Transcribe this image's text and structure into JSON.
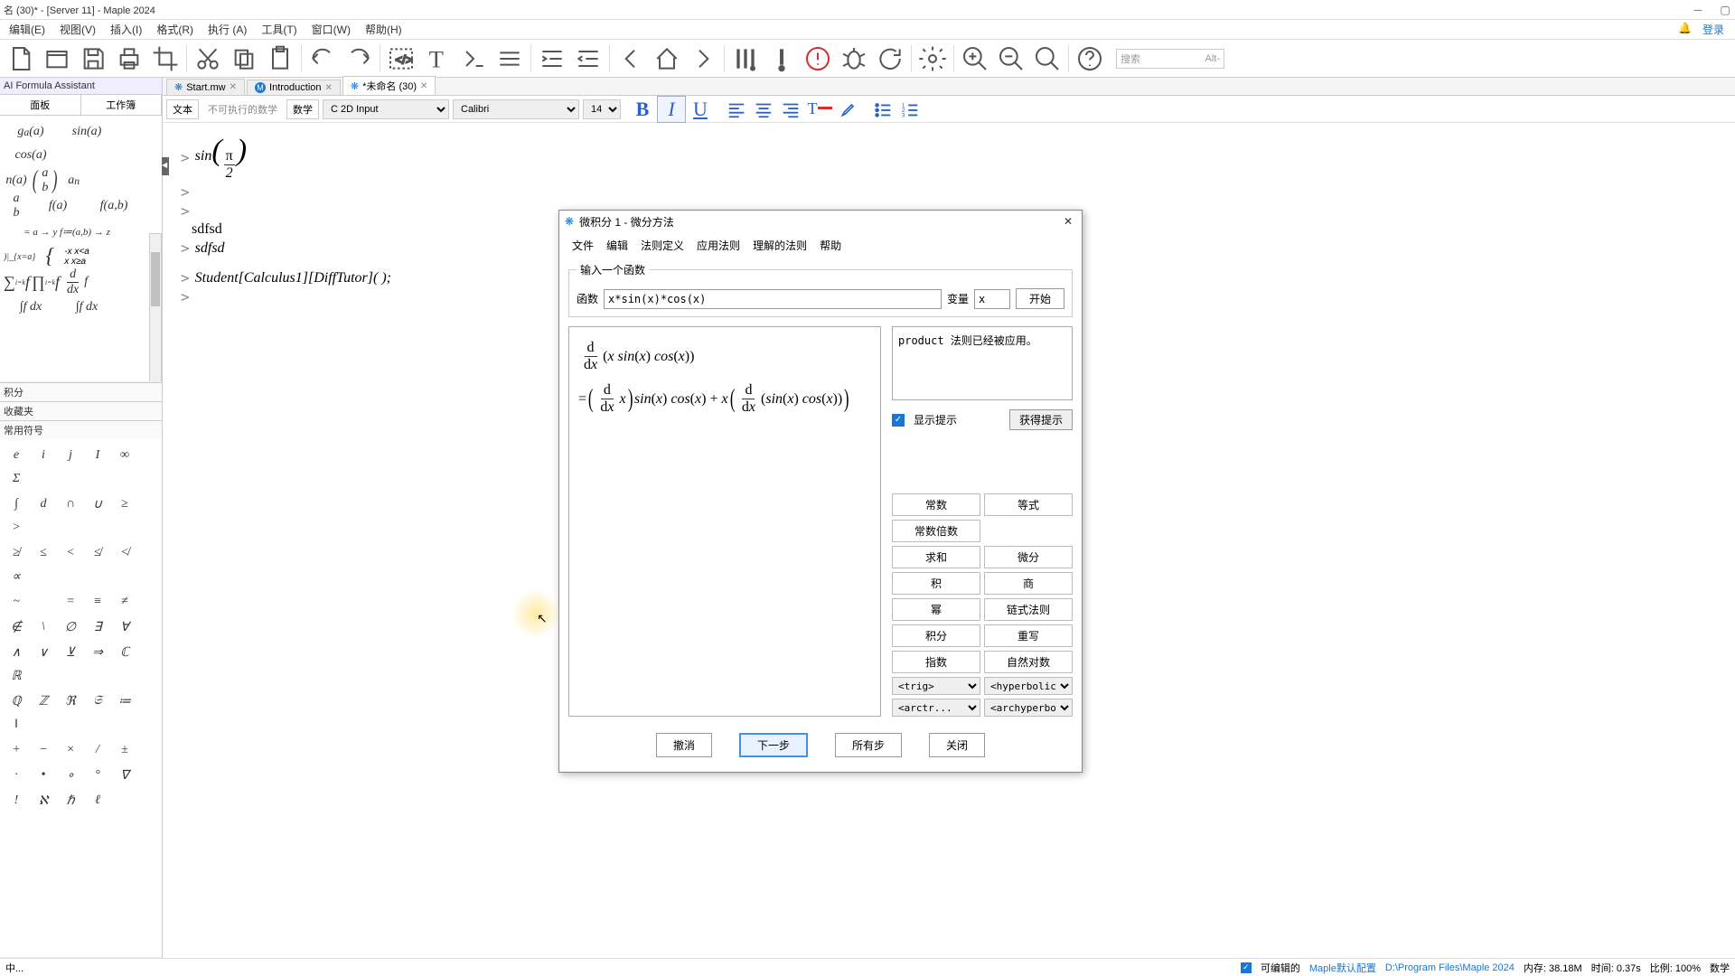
{
  "title": "名 (30)* - [Server 11] - Maple 2024",
  "window_controls": {
    "min": "─",
    "max": "▢",
    "close": ""
  },
  "login": {
    "bell": "🔔",
    "text": "登录"
  },
  "menu": [
    "编辑(E)",
    "视图(V)",
    "插入(I)",
    "格式(R)",
    "执行 (A)",
    "工具(T)",
    "窗口(W)",
    "帮助(H)"
  ],
  "search": {
    "placeholder": "搜索",
    "hint": "Alt-"
  },
  "left_panel": {
    "ai_tab": "AI Formula Assistant",
    "tabs": [
      "面板",
      "工作簿"
    ],
    "row1": [
      "g_a(a)",
      "sin(a)",
      "cos(a)"
    ],
    "row2": [
      "n(a)",
      "(a b)",
      "a_n"
    ],
    "row3": [
      "(a b)",
      "f(a)",
      "f(a,b)"
    ],
    "row4": "= a → y f≔(a,b) → z",
    "row5a": "-x   x<a",
    "row5b": "x   x≥a",
    "row5_prefix": ")|_{x=a}",
    "row6": [
      "∑f",
      "∏f",
      "d/dx f"
    ],
    "row7": [
      "∫f dx",
      "∫f dx"
    ],
    "sections": [
      "积分",
      "收藏夹",
      "常用符号"
    ],
    "symrows": [
      [
        "e",
        "i",
        "j",
        "I",
        "∞",
        "Σ"
      ],
      [
        "∫",
        "d",
        "∩",
        "∪",
        "≥",
        ">"
      ],
      [
        "≱",
        "≤",
        "<",
        "≰",
        "≮",
        "∝"
      ],
      [
        "~",
        "",
        "=",
        "≡",
        "≠"
      ],
      [
        "∉",
        "\\",
        "∅",
        "∃",
        "∀"
      ],
      [
        "∧",
        "∨",
        "⊻",
        "⇒",
        "ℂ",
        "ℝ"
      ],
      [
        "ℚ",
        "ℤ",
        "ℜ",
        "𝔖",
        ":=",
        "‖"
      ],
      [
        "+",
        "−",
        "×",
        "/",
        "±"
      ],
      [
        "·",
        "•",
        "∘",
        "°",
        "∇"
      ],
      [
        "!",
        "ℵ",
        "ℏ",
        "ℓ"
      ]
    ]
  },
  "doc_tabs": [
    {
      "label": "Start.mw",
      "active": false
    },
    {
      "label": "Introduction",
      "active": false
    },
    {
      "label": "*未命名 (30)",
      "active": true
    }
  ],
  "format_bar": {
    "text_btn": "文本",
    "nonexec": "不可执行的数学",
    "math_btn": "数学",
    "style": "C  2D Input",
    "font": "Calibri",
    "size": "14"
  },
  "worksheet": {
    "sin_expr": "sin",
    "pi": "π",
    "two": "2",
    "l1": "sdfsd",
    "l2": "sdfsd",
    "l3": "Student[Calculus1][DiffTutor]( );"
  },
  "dialog": {
    "title": "微积分 1 - 微分方法",
    "menu": [
      "文件",
      "编辑",
      "法则定义",
      "应用法则",
      "理解的法则",
      "帮助"
    ],
    "fieldset_title": "输入一个函数",
    "fn_label": "函数",
    "fn_value": "x*sin(x)*cos(x)",
    "var_label": "变量",
    "var_value": "x",
    "start": "开始",
    "hint_text": "product 法则已经被应用。",
    "show_hint": "显示提示",
    "get_hint": "获得提示",
    "rules": {
      "const": "常数",
      "eq": "等式",
      "constmul": "常数倍数",
      "sum": "求和",
      "diff": "微分",
      "prod": "积",
      "quot": "商",
      "power": "幂",
      "chain": "链式法则",
      "int": "积分",
      "rewrite": "重写",
      "exp": "指数",
      "log": "自然对数",
      "trig": "<trig>",
      "hyp": "<hyperbolic>",
      "arctr": "<arctr...",
      "archyp": "<archyperbol..."
    },
    "buttons": {
      "undo": "撤消",
      "next": "下一步",
      "all": "所有步",
      "close": "关闭"
    }
  },
  "status": {
    "left": "中...",
    "editable": "可编辑的",
    "config": "Maple默认配置",
    "path": "D:\\Program Files\\Maple 2024",
    "mem": "内存: 38.18M",
    "time": "时间: 0.37s",
    "scale": "比例: 100%",
    "mode": "数学"
  }
}
